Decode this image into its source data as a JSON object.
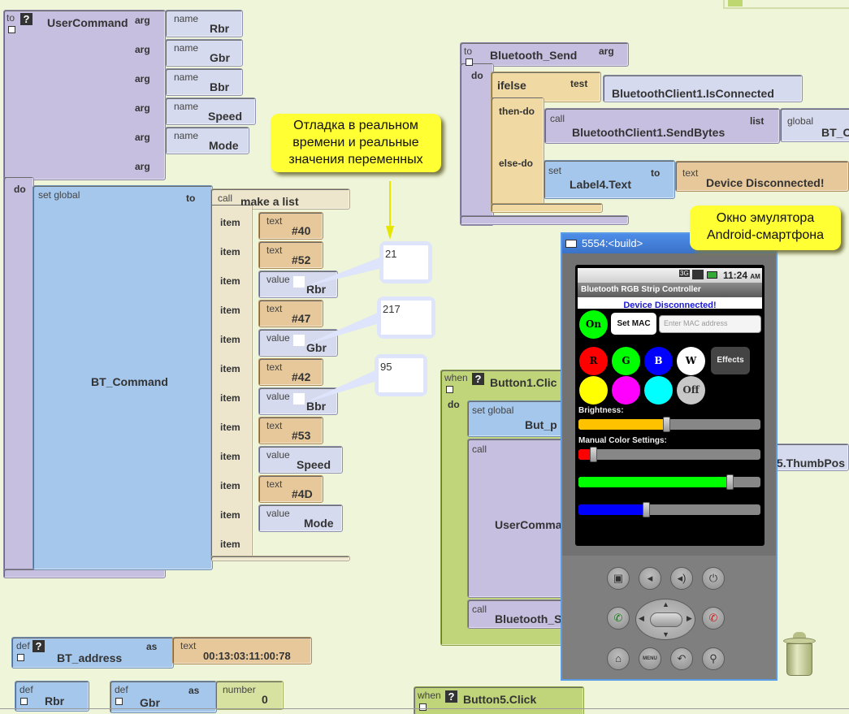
{
  "workspace": {
    "user_command": {
      "keyword_to": "to",
      "name": "UserCommand",
      "arg_label": "arg",
      "param_label": "name",
      "args": [
        "Rbr",
        "Gbr",
        "Bbr",
        "Speed",
        "Mode"
      ],
      "do_label": "do",
      "set_global_label": "set global",
      "var_name": "BT_Command",
      "to_label": "to",
      "call_label": "call",
      "make_list_label": "make a list",
      "item_label": "item",
      "items": [
        {
          "kind": "text",
          "label": "text",
          "value": "#40"
        },
        {
          "kind": "text",
          "label": "text",
          "value": "#52"
        },
        {
          "kind": "value",
          "label": "value",
          "value": "Rbr"
        },
        {
          "kind": "text",
          "label": "text",
          "value": "#47"
        },
        {
          "kind": "value",
          "label": "value",
          "value": "Gbr"
        },
        {
          "kind": "text",
          "label": "text",
          "value": "#42"
        },
        {
          "kind": "value",
          "label": "value",
          "value": "Bbr"
        },
        {
          "kind": "text",
          "label": "text",
          "value": "#53"
        },
        {
          "kind": "value",
          "label": "value",
          "value": "Speed"
        },
        {
          "kind": "text",
          "label": "text",
          "value": "#4D"
        },
        {
          "kind": "value",
          "label": "value",
          "value": "Mode"
        },
        {
          "kind": "empty",
          "label": "",
          "value": ""
        }
      ],
      "watch_values": {
        "Rbr": "21",
        "Gbr": "217",
        "Bbr": "95"
      }
    },
    "annotations": {
      "debug_note": [
        "Отладка в реальном",
        "времени и реальные",
        "значения переменных"
      ],
      "emulator_note": [
        "Окно эмулятора",
        "Android-смартфона"
      ]
    },
    "bluetooth_send": {
      "keyword_to": "to",
      "name": "Bluetooth_Send",
      "arg_label": "arg",
      "do_label": "do",
      "ifelse_label": "ifelse",
      "test_label": "test",
      "test_value": "BluetoothClient1.IsConnected",
      "then_label": "then-do",
      "call_label": "call",
      "send_method": "BluetoothClient1.SendBytes",
      "list_label": "list",
      "global_label": "global",
      "global_value": "BT_C",
      "else_label": "else-do",
      "set_label": "set",
      "set_target": "Label4.Text",
      "to_label": "to",
      "text_label": "text",
      "text_value": "Device Disconnected!"
    },
    "button1": {
      "when_label": "when",
      "event": "Button1.Clic",
      "do_label": "do",
      "set_global_label": "set global",
      "set_global_var": "But_p",
      "call_label": "call",
      "call_proc": "UserComma",
      "call2_label": "call",
      "call2_proc": "Bluetooth_S",
      "thumb_fragment": "5.ThumbPos"
    },
    "button5": {
      "when_label": "when",
      "event": "Button5.Click"
    },
    "defs": {
      "bt_address": {
        "def_label": "def",
        "name": "BT_address",
        "as_label": "as",
        "type_label": "text",
        "value": "00:13:03:11:00:78"
      },
      "rbr": {
        "def_label": "def",
        "name": "Rbr"
      },
      "gbr": {
        "def_label": "def",
        "name": "Gbr",
        "as_label": "as",
        "type_label": "number",
        "value": "0"
      }
    }
  },
  "emulator": {
    "title": "5554:<build>",
    "status_time": "11:24",
    "status_ampm": "AM",
    "status_network": "3G",
    "app_title": "Bluetooth RGB Strip Controller",
    "status_message": "Device Disconnected!",
    "on_button": "On",
    "set_mac_button": "Set MAC",
    "mac_placeholder": "Enter MAC address",
    "color_buttons": [
      {
        "label": "R",
        "color": "#ff0000",
        "text_color": "#000000"
      },
      {
        "label": "G",
        "color": "#00ff00",
        "text_color": "#000000"
      },
      {
        "label": "B",
        "color": "#0000ff",
        "text_color": "#ffffff"
      },
      {
        "label": "W",
        "color": "#ffffff",
        "text_color": "#000000"
      }
    ],
    "effects_button": "Effects",
    "color_buttons_row2": [
      {
        "label": "",
        "color": "#ffff00"
      },
      {
        "label": "",
        "color": "#ff00ff"
      },
      {
        "label": "",
        "color": "#00ffff"
      },
      {
        "label": "Off",
        "color": "#c8c8c8"
      }
    ],
    "brightness_label": "Brightness:",
    "brightness_value": 0.48,
    "manual_label": "Manual Color Settings:",
    "sliders": [
      {
        "name": "red",
        "color": "#ff0000",
        "value": 0.08
      },
      {
        "name": "green",
        "color": "#00ff00",
        "value": 0.83
      },
      {
        "name": "blue",
        "color": "#0000ff",
        "value": 0.37
      }
    ],
    "hardware_keys": [
      "camera",
      "volume-down",
      "volume-up",
      "power",
      "call",
      "dpad",
      "end-call",
      "home",
      "menu",
      "back",
      "search"
    ],
    "menu_key_label": "MENU"
  }
}
